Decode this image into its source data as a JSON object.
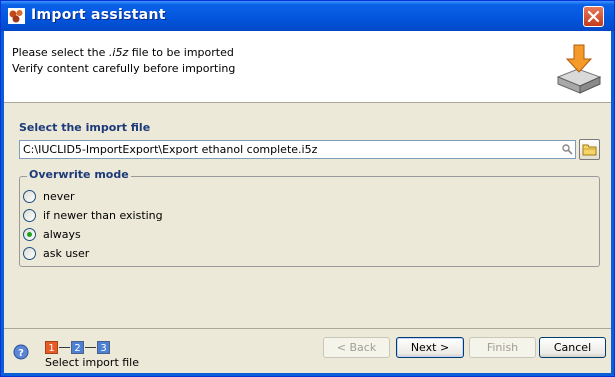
{
  "window": {
    "title": "Import assistant"
  },
  "header": {
    "line1_prefix": "Please select the ",
    "line1_ext": ".i5z",
    "line1_suffix": " file to be imported",
    "line2": "Verify content carefully before importing"
  },
  "import_file": {
    "label": "Select the import file",
    "path": "C:\\IUCLID5-ImportExport\\Export ethanol complete.i5z"
  },
  "overwrite": {
    "legend": "Overwrite mode",
    "options": [
      {
        "label": "never",
        "checked": false
      },
      {
        "label": "if newer than existing",
        "checked": false
      },
      {
        "label": "always",
        "checked": true
      },
      {
        "label": "ask user",
        "checked": false
      }
    ]
  },
  "wizard": {
    "steps": [
      "1",
      "2",
      "3"
    ],
    "current_step": 1,
    "caption": "Select import file"
  },
  "buttons": {
    "back": "< Back",
    "next": "Next >",
    "finish": "Finish",
    "cancel": "Cancel"
  },
  "colors": {
    "title_bar": "#0355dc",
    "section_text": "#1c3a7a",
    "active_step": "#e55c26",
    "inactive_step": "#4b80d6"
  }
}
